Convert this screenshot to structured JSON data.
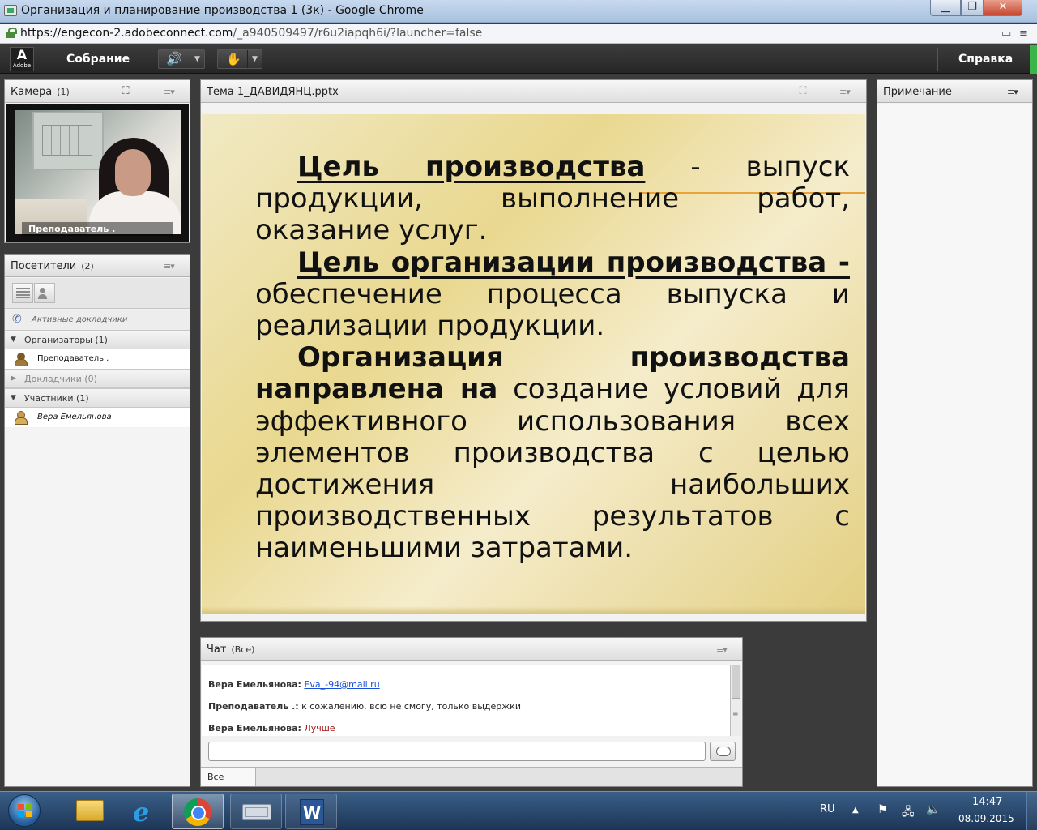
{
  "browser": {
    "window_title": "Организация и планирование производства 1 (3к) - Google Chrome",
    "url_host": "https://engecon-2.adobeconnect.com",
    "url_path": "/_a940509497/r6u2iapqh6i/?launcher=false"
  },
  "menubar": {
    "logo_letter": "A",
    "logo_text": "Adobe",
    "meeting_label": "Собрание",
    "help_label": "Справка",
    "speaker_icon": "speaker-icon",
    "mic_icon": "microphone-icon"
  },
  "camera_pod": {
    "title": "Камера",
    "count": "(1)",
    "video_label": "Преподаватель ."
  },
  "attendees_pod": {
    "title": "Посетители",
    "count": "(2)",
    "active_speakers": "Активные докладчики",
    "groups": [
      {
        "label": "Организаторы (1)",
        "members": [
          "Преподаватель ."
        ]
      },
      {
        "label": "Докладчики (0)",
        "members": []
      },
      {
        "label": "Участники (1)",
        "members": [
          "Вера Емельянова"
        ]
      }
    ]
  },
  "share_pod": {
    "title": "Тема 1_ДАВИДЯНЦ.pptx",
    "slide": {
      "p1_bold": "Цель производства",
      "p1_rest": " - выпуск продукции, выполнение работ, оказание услуг.",
      "p2_bold": "Цель организации производства -",
      "p2_rest": " обеспечение процесса выпуска и реализации продукции.",
      "p3_bold": "Организация производства направлена на",
      "p3_rest": " создание условий для эффективного использования всех элементов производства с целью достижения наибольших производственных результатов с наименьшими затратами."
    }
  },
  "notes_pod": {
    "title": "Примечание"
  },
  "chat_pod": {
    "title": "Чат",
    "scope": "(Все)",
    "messages": [
      {
        "author": "Вера Емельянова:",
        "text": "Eva_-94@mail.ru"
      },
      {
        "author": "Преподаватель .:",
        "text": "к сожалению, всю не смогу, только выдержки"
      },
      {
        "author": "Вера Емельянова:",
        "text": "Лучше"
      }
    ],
    "input_value": "",
    "tab_label": "Все"
  },
  "taskbar": {
    "language": "RU",
    "time": "14:47",
    "date": "08.09.2015",
    "word_icon_letter": "W",
    "ie_icon_letter": "e"
  },
  "colors": {
    "menubar_bg": "#2e2e2e",
    "slide_bg": "#ecdca0",
    "link_blue": "#1a4fd8",
    "chat_red": "#a31414",
    "speaker_green": "#4bd14b"
  }
}
